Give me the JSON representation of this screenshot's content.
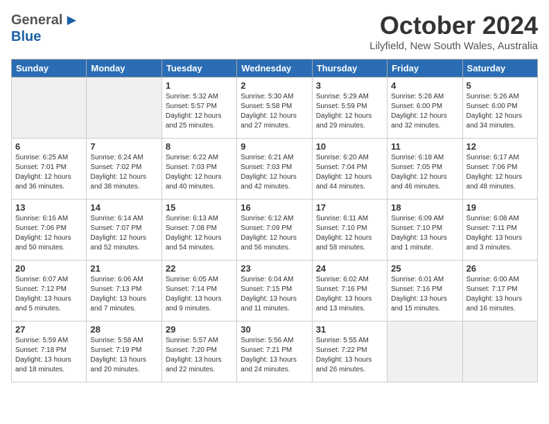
{
  "header": {
    "logo_general": "General",
    "logo_blue": "Blue",
    "month_title": "October 2024",
    "location": "Lilyfield, New South Wales, Australia"
  },
  "weekdays": [
    "Sunday",
    "Monday",
    "Tuesday",
    "Wednesday",
    "Thursday",
    "Friday",
    "Saturday"
  ],
  "weeks": [
    [
      {
        "day": "",
        "info": ""
      },
      {
        "day": "",
        "info": ""
      },
      {
        "day": "1",
        "info": "Sunrise: 5:32 AM\nSunset: 5:57 PM\nDaylight: 12 hours\nand 25 minutes."
      },
      {
        "day": "2",
        "info": "Sunrise: 5:30 AM\nSunset: 5:58 PM\nDaylight: 12 hours\nand 27 minutes."
      },
      {
        "day": "3",
        "info": "Sunrise: 5:29 AM\nSunset: 5:59 PM\nDaylight: 12 hours\nand 29 minutes."
      },
      {
        "day": "4",
        "info": "Sunrise: 5:28 AM\nSunset: 6:00 PM\nDaylight: 12 hours\nand 32 minutes."
      },
      {
        "day": "5",
        "info": "Sunrise: 5:26 AM\nSunset: 6:00 PM\nDaylight: 12 hours\nand 34 minutes."
      }
    ],
    [
      {
        "day": "6",
        "info": "Sunrise: 6:25 AM\nSunset: 7:01 PM\nDaylight: 12 hours\nand 36 minutes."
      },
      {
        "day": "7",
        "info": "Sunrise: 6:24 AM\nSunset: 7:02 PM\nDaylight: 12 hours\nand 38 minutes."
      },
      {
        "day": "8",
        "info": "Sunrise: 6:22 AM\nSunset: 7:03 PM\nDaylight: 12 hours\nand 40 minutes."
      },
      {
        "day": "9",
        "info": "Sunrise: 6:21 AM\nSunset: 7:03 PM\nDaylight: 12 hours\nand 42 minutes."
      },
      {
        "day": "10",
        "info": "Sunrise: 6:20 AM\nSunset: 7:04 PM\nDaylight: 12 hours\nand 44 minutes."
      },
      {
        "day": "11",
        "info": "Sunrise: 6:18 AM\nSunset: 7:05 PM\nDaylight: 12 hours\nand 46 minutes."
      },
      {
        "day": "12",
        "info": "Sunrise: 6:17 AM\nSunset: 7:06 PM\nDaylight: 12 hours\nand 48 minutes."
      }
    ],
    [
      {
        "day": "13",
        "info": "Sunrise: 6:16 AM\nSunset: 7:06 PM\nDaylight: 12 hours\nand 50 minutes."
      },
      {
        "day": "14",
        "info": "Sunrise: 6:14 AM\nSunset: 7:07 PM\nDaylight: 12 hours\nand 52 minutes."
      },
      {
        "day": "15",
        "info": "Sunrise: 6:13 AM\nSunset: 7:08 PM\nDaylight: 12 hours\nand 54 minutes."
      },
      {
        "day": "16",
        "info": "Sunrise: 6:12 AM\nSunset: 7:09 PM\nDaylight: 12 hours\nand 56 minutes."
      },
      {
        "day": "17",
        "info": "Sunrise: 6:11 AM\nSunset: 7:10 PM\nDaylight: 12 hours\nand 58 minutes."
      },
      {
        "day": "18",
        "info": "Sunrise: 6:09 AM\nSunset: 7:10 PM\nDaylight: 13 hours\nand 1 minute."
      },
      {
        "day": "19",
        "info": "Sunrise: 6:08 AM\nSunset: 7:11 PM\nDaylight: 13 hours\nand 3 minutes."
      }
    ],
    [
      {
        "day": "20",
        "info": "Sunrise: 6:07 AM\nSunset: 7:12 PM\nDaylight: 13 hours\nand 5 minutes."
      },
      {
        "day": "21",
        "info": "Sunrise: 6:06 AM\nSunset: 7:13 PM\nDaylight: 13 hours\nand 7 minutes."
      },
      {
        "day": "22",
        "info": "Sunrise: 6:05 AM\nSunset: 7:14 PM\nDaylight: 13 hours\nand 9 minutes."
      },
      {
        "day": "23",
        "info": "Sunrise: 6:04 AM\nSunset: 7:15 PM\nDaylight: 13 hours\nand 11 minutes."
      },
      {
        "day": "24",
        "info": "Sunrise: 6:02 AM\nSunset: 7:16 PM\nDaylight: 13 hours\nand 13 minutes."
      },
      {
        "day": "25",
        "info": "Sunrise: 6:01 AM\nSunset: 7:16 PM\nDaylight: 13 hours\nand 15 minutes."
      },
      {
        "day": "26",
        "info": "Sunrise: 6:00 AM\nSunset: 7:17 PM\nDaylight: 13 hours\nand 16 minutes."
      }
    ],
    [
      {
        "day": "27",
        "info": "Sunrise: 5:59 AM\nSunset: 7:18 PM\nDaylight: 13 hours\nand 18 minutes."
      },
      {
        "day": "28",
        "info": "Sunrise: 5:58 AM\nSunset: 7:19 PM\nDaylight: 13 hours\nand 20 minutes."
      },
      {
        "day": "29",
        "info": "Sunrise: 5:57 AM\nSunset: 7:20 PM\nDaylight: 13 hours\nand 22 minutes."
      },
      {
        "day": "30",
        "info": "Sunrise: 5:56 AM\nSunset: 7:21 PM\nDaylight: 13 hours\nand 24 minutes."
      },
      {
        "day": "31",
        "info": "Sunrise: 5:55 AM\nSunset: 7:22 PM\nDaylight: 13 hours\nand 26 minutes."
      },
      {
        "day": "",
        "info": ""
      },
      {
        "day": "",
        "info": ""
      }
    ]
  ]
}
